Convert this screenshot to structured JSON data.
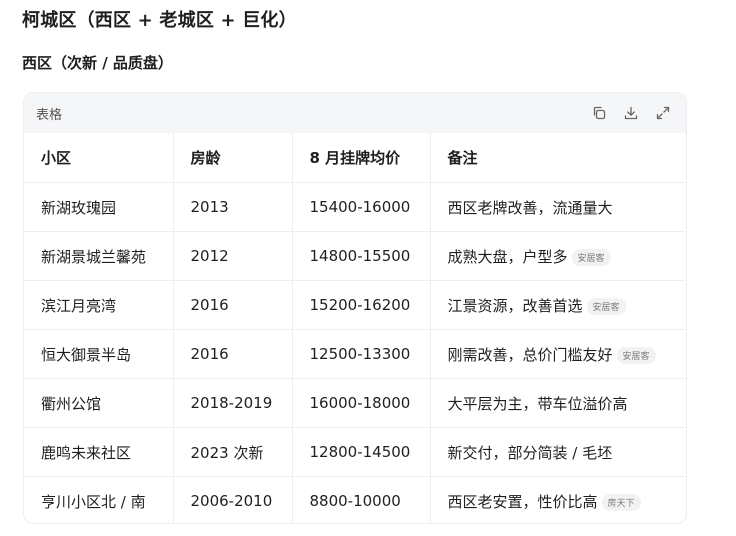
{
  "heading": "柯城区（西区 + 老城区 + 巨化）",
  "subheading": "西区（次新 / 品质盘）",
  "card": {
    "title": "表格",
    "tools": [
      "copy-icon",
      "download-icon",
      "expand-icon"
    ]
  },
  "table": {
    "headers": [
      "小区",
      "房龄",
      "8 月挂牌均价",
      "备注"
    ],
    "rows": [
      {
        "name": "新湖玫瑰园",
        "age": "2013",
        "price": "15400-16000",
        "note": "西区老牌改善，流通量大",
        "tag": ""
      },
      {
        "name": "新湖景城兰馨苑",
        "age": "2012",
        "price": "14800-15500",
        "note": "成熟大盘，户型多",
        "tag": "安居客"
      },
      {
        "name": "滨江月亮湾",
        "age": "2016",
        "price": "15200-16200",
        "note": "江景资源，改善首选",
        "tag": "安居客"
      },
      {
        "name": "恒大御景半岛",
        "age": "2016",
        "price": "12500-13300",
        "note": "刚需改善，总价门槛友好",
        "tag": "安居客"
      },
      {
        "name": "衢州公馆",
        "age": "2018-2019",
        "price": "16000-18000",
        "note": "大平层为主，带车位溢价高",
        "tag": ""
      },
      {
        "name": "鹿鸣未来社区",
        "age": "2023 次新",
        "price": "12800-14500",
        "note": "新交付，部分简装 / 毛坯",
        "tag": ""
      },
      {
        "name": "亨川小区北 / 南",
        "age": "2006-2010",
        "price": "8800-10000",
        "note": "西区老安置，性价比高",
        "tag": "房天下"
      }
    ]
  }
}
